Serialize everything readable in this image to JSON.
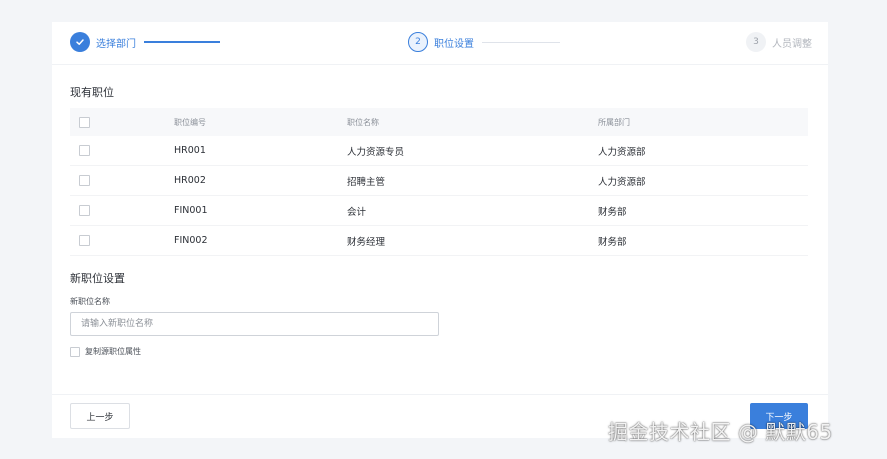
{
  "steps": [
    {
      "number": "1",
      "label": "选择部门",
      "state": "done"
    },
    {
      "number": "2",
      "label": "职位设置",
      "state": "active"
    },
    {
      "number": "3",
      "label": "人员调整",
      "state": "pending"
    }
  ],
  "existing": {
    "title": "现有职位",
    "headers": {
      "code": "职位编号",
      "name": "职位名称",
      "dept": "所属部门"
    },
    "rows": [
      {
        "code": "HR001",
        "name": "人力资源专员",
        "dept": "人力资源部"
      },
      {
        "code": "HR002",
        "name": "招聘主管",
        "dept": "人力资源部"
      },
      {
        "code": "FIN001",
        "name": "会计",
        "dept": "财务部"
      },
      {
        "code": "FIN002",
        "name": "财务经理",
        "dept": "财务部"
      }
    ]
  },
  "new_position": {
    "title": "新职位设置",
    "field_label": "新职位名称",
    "placeholder": "请输入新职位名称",
    "value": "",
    "copy_label": "复制源职位属性"
  },
  "footer": {
    "prev_label": "上一步",
    "next_label": "下一步"
  },
  "watermark": "掘金技术社区 @ 默默65",
  "colors": {
    "accent": "#3a7fdc",
    "background": "#f3f5f8"
  }
}
